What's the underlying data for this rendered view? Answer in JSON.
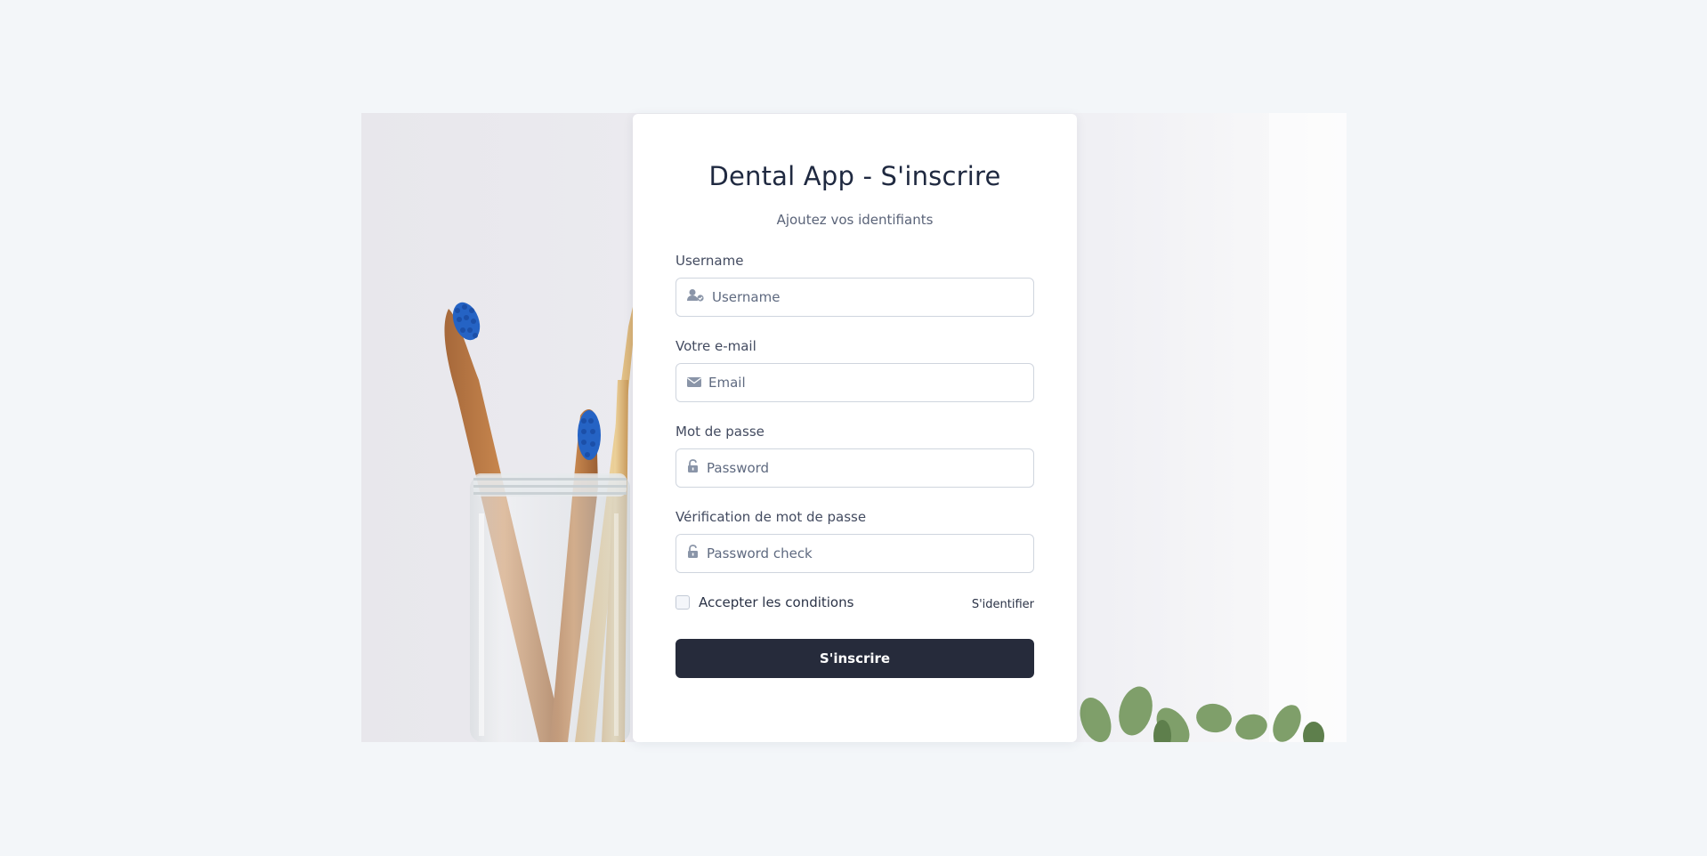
{
  "signup": {
    "title": "Dental App - S'inscrire",
    "subtitle": "Ajoutez vos identifiants",
    "username": {
      "label": "Username",
      "placeholder": "Username",
      "icon": "user-check-icon"
    },
    "email": {
      "label": "Votre e-mail",
      "placeholder": "Email",
      "icon": "envelope-icon"
    },
    "password": {
      "label": "Mot de passe",
      "placeholder": "Password",
      "icon": "unlock-icon"
    },
    "password_check": {
      "label": "Vérification de mot de passe",
      "placeholder": "Password check",
      "icon": "unlock-icon"
    },
    "accept_terms": {
      "label": "Accepter les conditions",
      "checked": false
    },
    "login_link": "S'identifier",
    "submit_label": "S'inscrire"
  },
  "colors": {
    "page_background": "#f3f6f9",
    "button": "#262b3b",
    "text": "#1f2940",
    "toothbrush_head": "#2563c4"
  }
}
